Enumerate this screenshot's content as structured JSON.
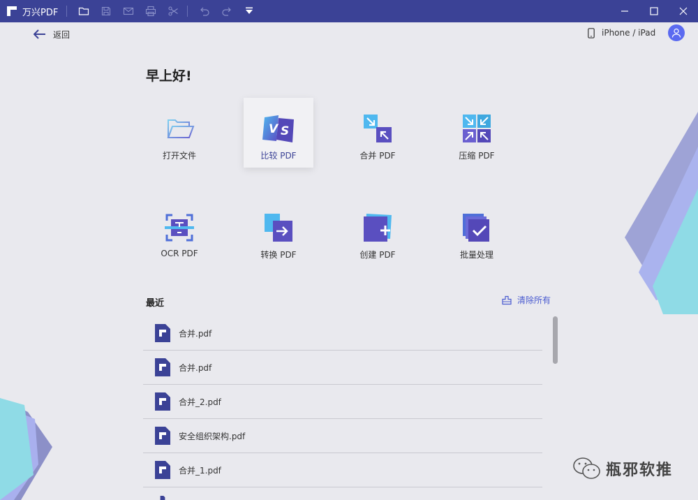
{
  "titlebar": {
    "app_name": "万兴PDF",
    "tools": [
      "folder-icon",
      "save-icon",
      "mail-icon",
      "print-icon",
      "cut-icon",
      "undo-icon",
      "redo-icon",
      "dropdown-icon"
    ],
    "window_controls": [
      "minimize-icon",
      "maximize-icon",
      "close-icon"
    ]
  },
  "header": {
    "back_label": "返回",
    "device_label": "iPhone / iPad"
  },
  "greeting": "早上好!",
  "tiles": [
    {
      "label": "打开文件",
      "icon": "open-folder-icon"
    },
    {
      "label": "比较 PDF",
      "icon": "compare-icon",
      "active": true
    },
    {
      "label": "合并 PDF",
      "icon": "merge-icon"
    },
    {
      "label": "压缩 PDF",
      "icon": "compress-icon"
    },
    {
      "label": "OCR PDF",
      "icon": "ocr-icon"
    },
    {
      "label": "转换 PDF",
      "icon": "convert-icon"
    },
    {
      "label": "创建 PDF",
      "icon": "create-icon"
    },
    {
      "label": "批量处理",
      "icon": "batch-icon"
    }
  ],
  "recent": {
    "title": "最近",
    "clear_label": "清除所有",
    "files": [
      "合并.pdf",
      "合并.pdf",
      "合并_2.pdf",
      "安全组织架构.pdf",
      "合并_1.pdf"
    ]
  },
  "watermark": "瓶邪软推",
  "colors": {
    "titlebar": "#3b4296",
    "accent": "#4a5bd0",
    "background": "#e9e9ee"
  }
}
